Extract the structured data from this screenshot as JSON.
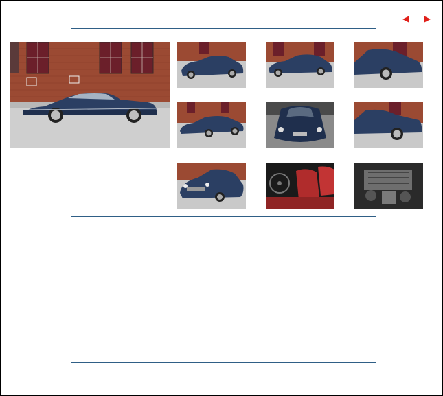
{
  "gallery": {
    "nav": {
      "prev_icon": "left-arrow-icon",
      "next_icon": "right-arrow-icon",
      "arrow_color": "#e0201a"
    },
    "rule_color": "#2f5f86",
    "main_photo": {
      "subject": "side-view-coupe",
      "car_color": "#2b3f63"
    },
    "thumbnails": [
      {
        "subject": "front-three-quarter"
      },
      {
        "subject": "front-three-quarter-wide"
      },
      {
        "subject": "side-close"
      },
      {
        "subject": "rear-three-quarter"
      },
      {
        "subject": "front-top"
      },
      {
        "subject": "side-rear-close"
      },
      {
        "subject": "front-low"
      },
      {
        "subject": "red-leather-interior"
      },
      {
        "subject": "engine-bay"
      }
    ]
  }
}
